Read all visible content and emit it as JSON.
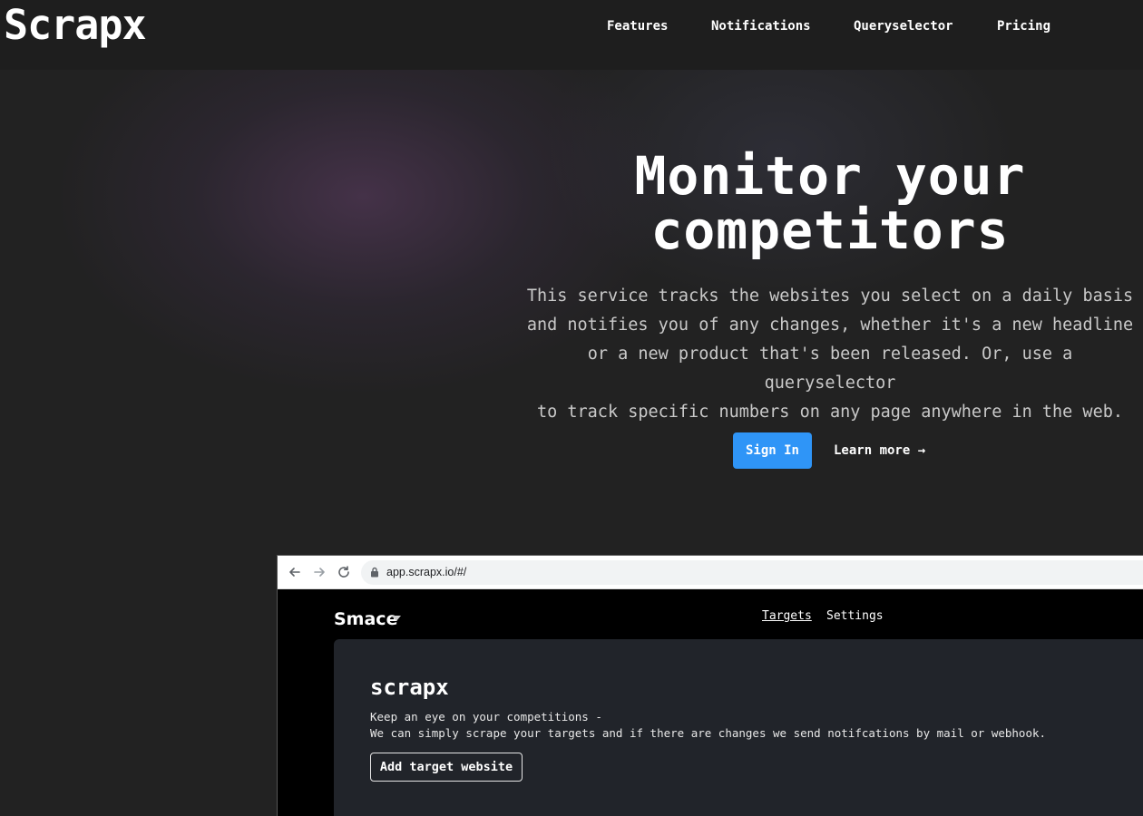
{
  "header": {
    "logo": "Scrapx",
    "logo_shadow_letter": "S",
    "nav": [
      {
        "label": "Features"
      },
      {
        "label": "Notifications"
      },
      {
        "label": "Queryselector"
      },
      {
        "label": "Pricing"
      }
    ]
  },
  "hero": {
    "title_line1": "Monitor your",
    "title_line2": "competitors",
    "description": [
      "This service tracks the websites you select on a daily basis",
      "and notifies you of any changes, whether it's a new headline",
      "or a new product that's been released. Or, use a queryselector",
      "to track specific numbers on any page anywhere in the web."
    ],
    "signin_label": "Sign In",
    "learn_more_label": "Learn more →",
    "signin_color": "#2f95f7"
  },
  "browser_mockup": {
    "url": "app.scrapx.io/#/",
    "icons": [
      "back-arrow-icon",
      "forward-arrow-icon",
      "reload-icon",
      "lock-icon"
    ],
    "app": {
      "brand": "Smace",
      "nav_targets": "Targets",
      "nav_settings": "Settings",
      "card_title": "scrapx",
      "card_line1": "Keep an eye on your competitions -",
      "card_line2": "We can simply scrape your targets and if there are changes we send notifcations by mail or webhook.",
      "add_button": "Add target website"
    }
  }
}
